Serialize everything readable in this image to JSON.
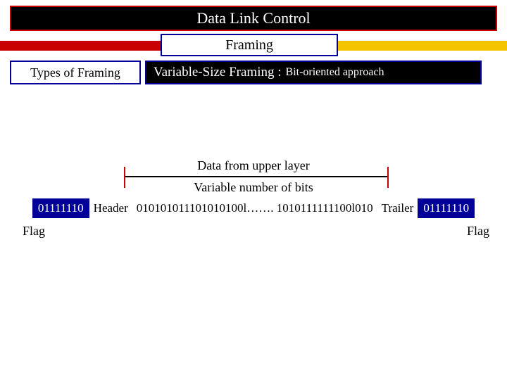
{
  "title": "Data Link Control",
  "subtitle": "Framing",
  "types_label": "Types of  Framing",
  "variable_label_main": "Variable-Size Framing :",
  "variable_label_sub": "Bit-oriented approach",
  "upper_layer": "Data from upper layer",
  "variable_bits": "Variable number of bits",
  "frame": {
    "flag_left": "01111110",
    "header": "Header",
    "data": "010101011101010100l……. 1010111111100l010",
    "trailer": "Trailer",
    "flag_right": "01111110"
  },
  "flag_label": "Flag"
}
